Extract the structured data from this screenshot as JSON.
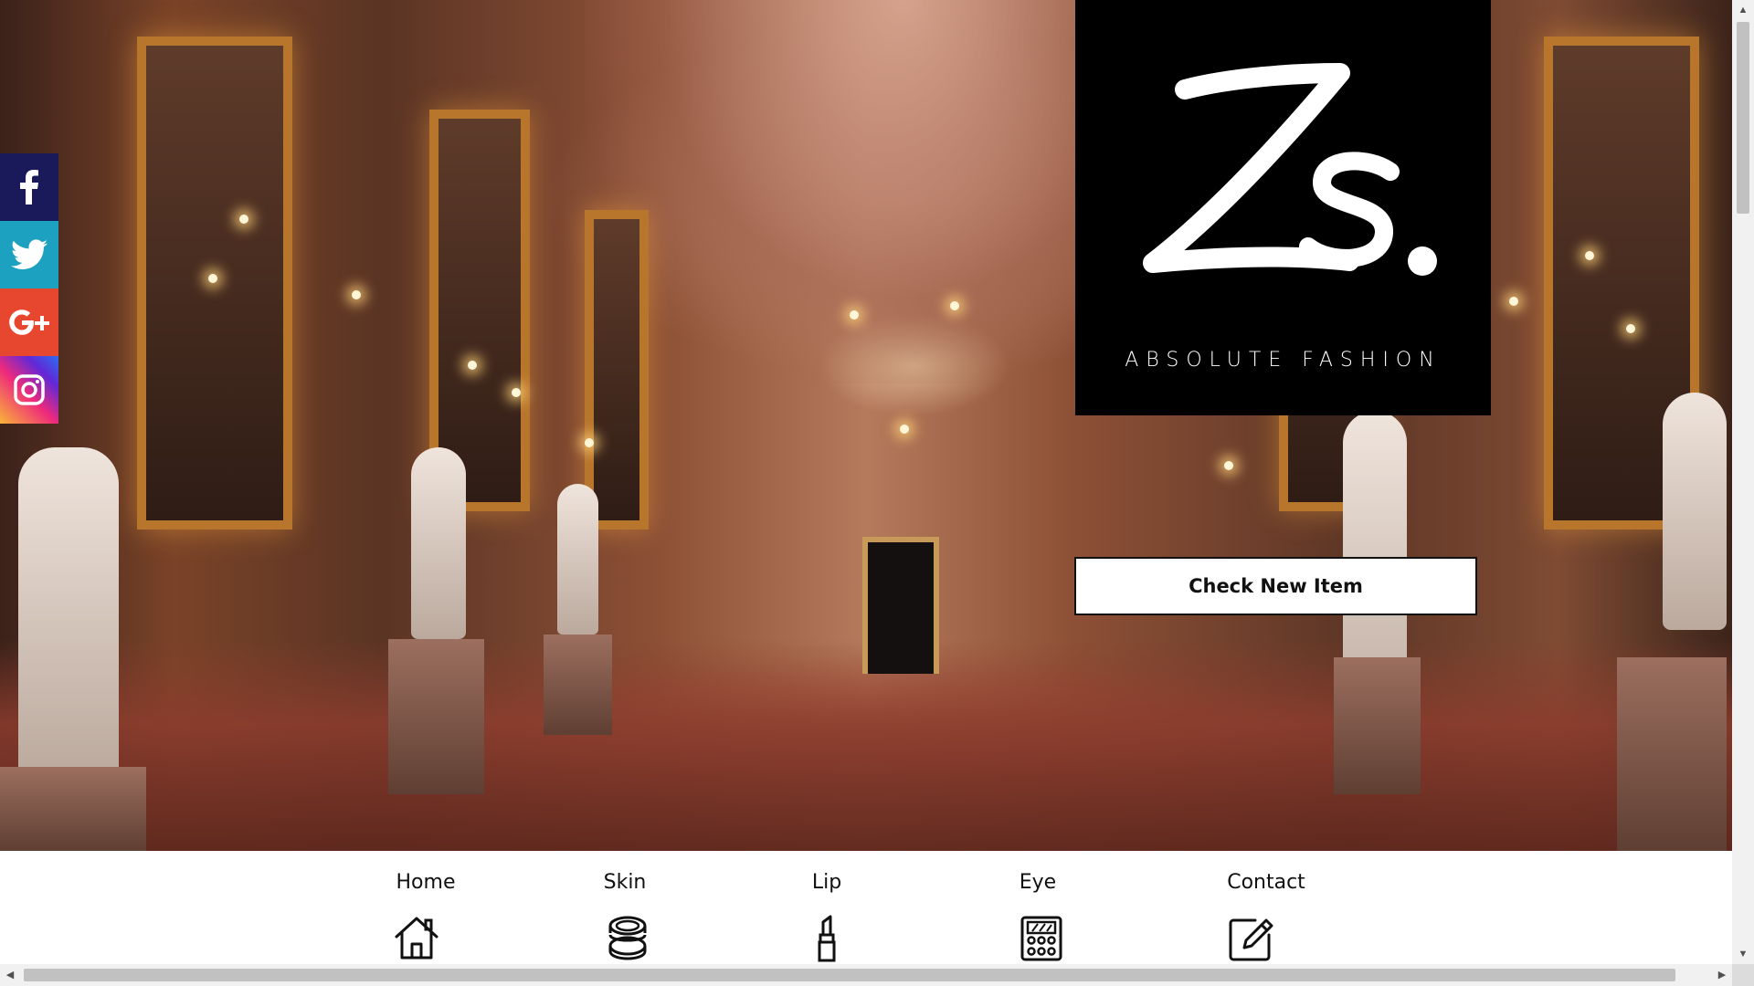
{
  "logo": {
    "mark_text": "Zs.",
    "tagline": "ABSOLUTE FASHION"
  },
  "hero": {
    "cta_label": "Check New Item"
  },
  "social": [
    {
      "name": "facebook",
      "icon": "facebook-icon",
      "color": "#1a1a5a"
    },
    {
      "name": "twitter",
      "icon": "twitter-icon",
      "color": "#1da1c1"
    },
    {
      "name": "google-plus",
      "icon": "google-plus-icon",
      "color": "#e8472f"
    },
    {
      "name": "instagram",
      "icon": "instagram-icon",
      "color": "#2d6df0"
    }
  ],
  "nav": {
    "items": [
      {
        "label": "Home",
        "icon": "house-icon"
      },
      {
        "label": "Skin",
        "icon": "compact-powder-icon"
      },
      {
        "label": "Lip",
        "icon": "lipstick-icon"
      },
      {
        "label": "Eye",
        "icon": "eyeshadow-palette-icon"
      },
      {
        "label": "Contact",
        "icon": "edit-icon"
      }
    ]
  }
}
